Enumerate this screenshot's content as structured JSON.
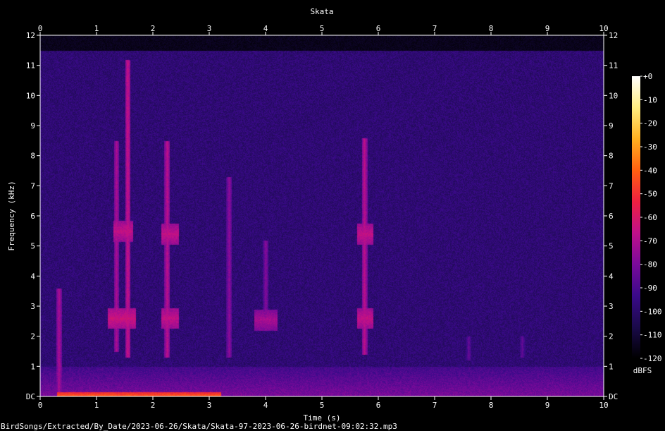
{
  "chart_data": {
    "type": "heatmap",
    "subtype": "spectrogram",
    "title": "Skata",
    "xlabel": "Time (s)",
    "ylabel": "Frequency (kHz)",
    "xlim": [
      0,
      10
    ],
    "ylim": [
      0,
      12
    ],
    "x_ticks": [
      0,
      1,
      2,
      3,
      4,
      5,
      6,
      7,
      8,
      9,
      10
    ],
    "y_ticks": [
      "DC",
      "1",
      "2",
      "3",
      "4",
      "5",
      "6",
      "7",
      "8",
      "9",
      "10",
      "11",
      "12"
    ],
    "colorbar": {
      "label": "dBFS",
      "range": [
        -120,
        0
      ],
      "ticks": [
        "+0",
        "-10",
        "-20",
        "-30",
        "-40",
        "-50",
        "-60",
        "-70",
        "-80",
        "-90",
        "-100",
        "-110",
        "-120"
      ],
      "colors": [
        "#000000",
        "#1a0a4a",
        "#3a0a8a",
        "#7a0a9a",
        "#c0108a",
        "#ee2040",
        "#ff6010",
        "#ffb020",
        "#ffee80",
        "#ffffff"
      ]
    },
    "background_level_dbfs": -100,
    "noise_ceiling_khz": 11.5,
    "low_freq_band": [
      {
        "t0": 0.3,
        "t1": 3.2,
        "f0": 0,
        "f1": 0.15,
        "level_dbfs": -45
      },
      {
        "t0": 0,
        "t1": 10,
        "f0": 0,
        "f1": 1.0,
        "level_dbfs": -85
      }
    ],
    "calls": [
      {
        "t": 0.33,
        "f0": 0.05,
        "f1": 3.6,
        "level_dbfs": -75
      },
      {
        "t": 1.35,
        "f0": 1.5,
        "f1": 8.5,
        "level_dbfs": -75
      },
      {
        "t": 1.55,
        "f0": 1.3,
        "f1": 11.2,
        "level_dbfs": -70
      },
      {
        "t": 2.25,
        "f0": 1.3,
        "f1": 8.5,
        "level_dbfs": -72
      },
      {
        "t": 3.35,
        "f0": 1.3,
        "f1": 7.3,
        "level_dbfs": -80
      },
      {
        "t": 4.0,
        "f0": 2.4,
        "f1": 5.2,
        "level_dbfs": -82
      },
      {
        "t": 5.75,
        "f0": 1.4,
        "f1": 8.6,
        "level_dbfs": -72
      },
      {
        "t": 7.6,
        "f0": 1.2,
        "f1": 2.0,
        "level_dbfs": -88
      },
      {
        "t": 8.55,
        "f0": 1.3,
        "f1": 2.0,
        "level_dbfs": -88
      }
    ],
    "hotspots": [
      {
        "t0": 1.2,
        "t1": 1.7,
        "f": 2.6,
        "level_dbfs": -68
      },
      {
        "t0": 1.3,
        "t1": 1.65,
        "f": 5.5,
        "level_dbfs": -70
      },
      {
        "t0": 2.15,
        "t1": 2.45,
        "f": 2.6,
        "level_dbfs": -70
      },
      {
        "t0": 2.15,
        "t1": 2.45,
        "f": 5.4,
        "level_dbfs": -70
      },
      {
        "t0": 3.8,
        "t1": 4.2,
        "f": 2.55,
        "level_dbfs": -75
      },
      {
        "t0": 5.62,
        "t1": 5.9,
        "f": 2.6,
        "level_dbfs": -70
      },
      {
        "t0": 5.62,
        "t1": 5.9,
        "f": 5.4,
        "level_dbfs": -70
      }
    ]
  },
  "footer": {
    "file_path": "BirdSongs/Extracted/By_Date/2023-06-26/Skata/Skata-97-2023-06-26-birdnet-09:02:32.mp3"
  }
}
